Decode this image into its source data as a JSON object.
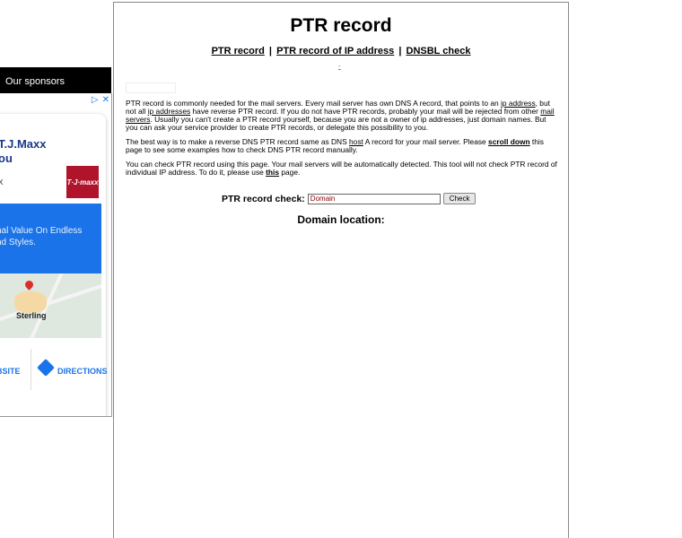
{
  "sidebar": {
    "sponsor_label": "Our sponsors",
    "ad": {
      "badge_icons": [
        "ad-info-icon",
        "close-icon"
      ],
      "title": "T.J.Maxx\nou",
      "subline": "x",
      "logo_text": "T·J·maxx",
      "promo": "nal Value On Endless\nnd Styles.",
      "map_label": "Sterling",
      "website_label": "BSITE",
      "directions_label": "DIRECTIONS",
      "brand_color": "#b0142b",
      "accent_color": "#1a73e8"
    }
  },
  "main": {
    "title": "PTR record",
    "nav": {
      "link1": "PTR record",
      "sep1": "|",
      "link2": "PTR record of IP address",
      "sep2": "|",
      "link3": "DNSBL check"
    },
    "tiny_link": "-",
    "para1": {
      "a": "PTR record is commonly needed for the mail servers. Every mail server has own DNS A record, that points to an ",
      "link1": "ip address",
      "b": ", but not all ",
      "link2": "ip addresses",
      "c": " have reverse PTR record. If you do not have PTR records, probably your mail will be rejected from other ",
      "link3": "mail servers",
      "d": ". Usually you can't create a PTR record yourself, because you are not a owner of ip addresses, just domain names. But you can ask your service provider to create PTR records, or delegate this possibility to you."
    },
    "para2": {
      "a": "The best way is to make a reverse DNS PTR record same as DNS ",
      "link1": "host",
      "b": " A record for your mail server. Please ",
      "link2": "scroll down",
      "c": " this page to see some examples how to check DNS PTR record manually."
    },
    "para3": {
      "a": "You can check PTR record using this page. Your mail servers will be automatically detected. This tool will not check PTR record of individual IP address. To do it, please use ",
      "link1": "this",
      "b": " page."
    },
    "check": {
      "label": "PTR record check:",
      "placeholder": "Domain",
      "button": "Check"
    },
    "domain_location": "Domain location:"
  }
}
